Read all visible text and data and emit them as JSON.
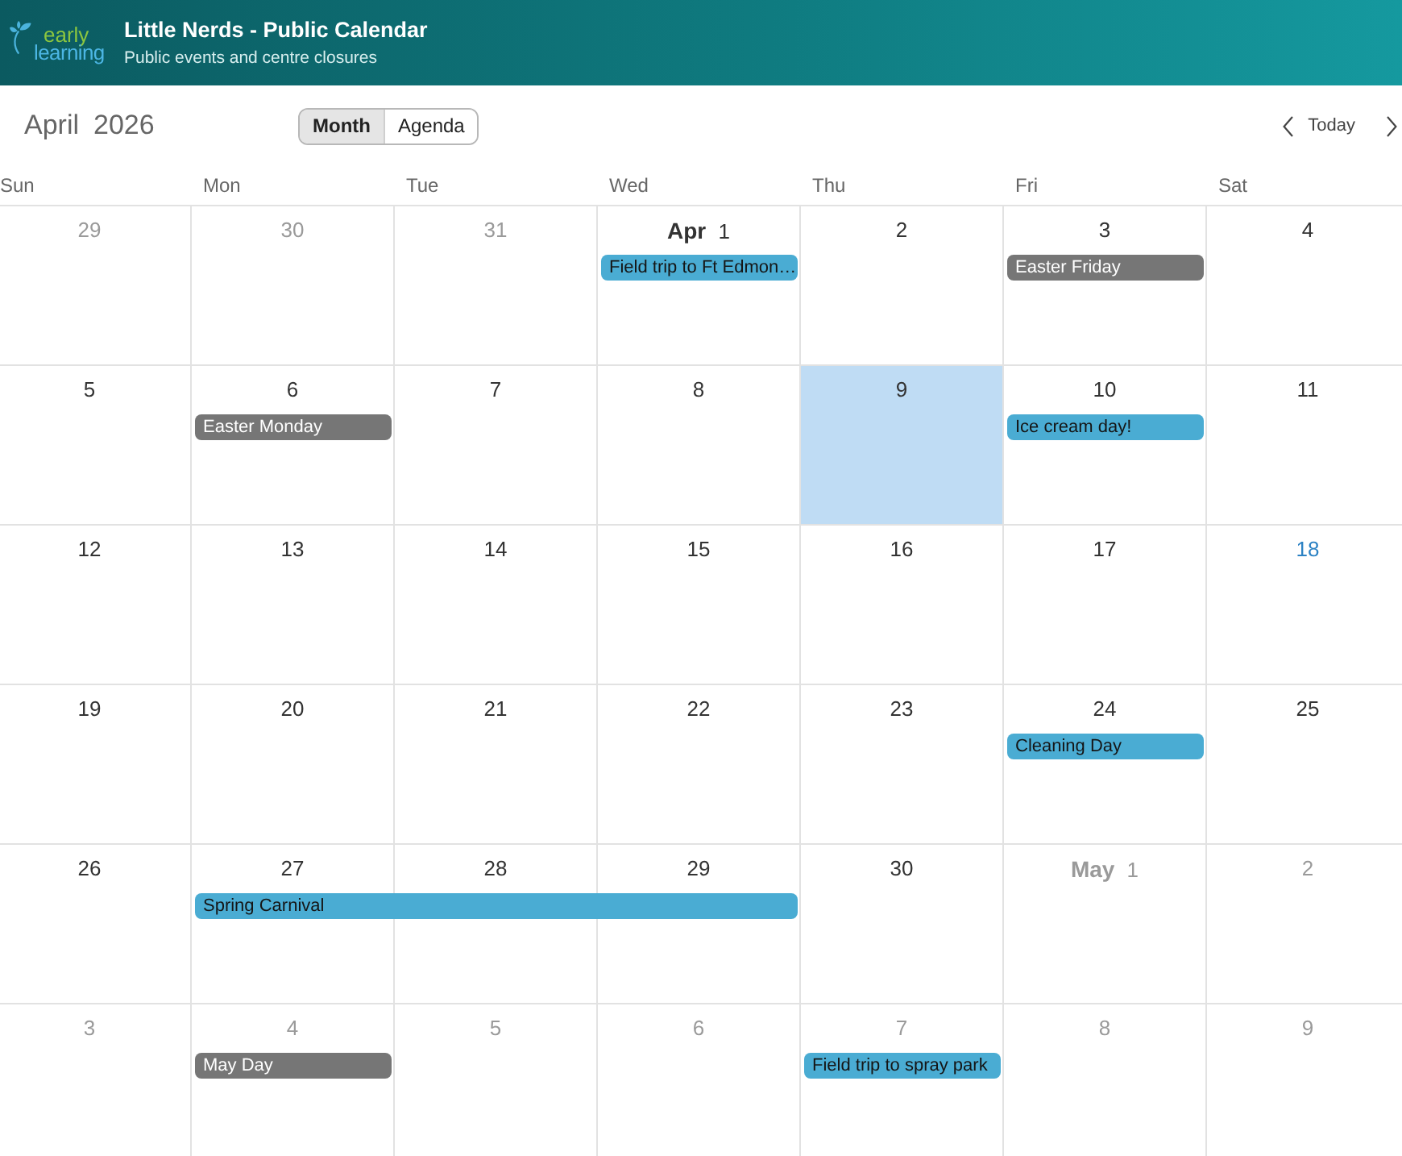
{
  "header": {
    "logo": {
      "line_1": "early",
      "line_2": "learning"
    },
    "title": "Little Nerds - Public Calendar",
    "subtitle": "Public events and centre closures"
  },
  "toolbar": {
    "month": "April",
    "year": "2026",
    "views": [
      {
        "label": "Month",
        "selected": true
      },
      {
        "label": "Agenda",
        "selected": false
      }
    ],
    "today_label": "Today"
  },
  "weekdays": [
    "Sun",
    "Mon",
    "Tue",
    "Wed",
    "Thu",
    "Fri",
    "Sat"
  ],
  "weeks": [
    {
      "days": [
        {
          "date": "29",
          "other_month": true,
          "today": false,
          "selected": false,
          "event_continues": false
        },
        {
          "date": "30",
          "other_month": true,
          "today": false,
          "selected": false,
          "event_continues": false
        },
        {
          "date": "31",
          "other_month": true,
          "today": false,
          "selected": false,
          "event_continues": false
        },
        {
          "date": "**Apr** 1",
          "other_month": false,
          "today": false,
          "selected": false,
          "event_continues": false,
          "events": [
            {
              "title": "Field trip to Ft Edmon…",
              "color": "#4aacd3"
            }
          ]
        },
        {
          "date": "2",
          "other_month": false,
          "today": false,
          "selected": false,
          "event_continues": false
        },
        {
          "date": "3",
          "other_month": false,
          "today": false,
          "selected": false,
          "event_continues": false,
          "events": [
            {
              "title": "Easter Friday",
              "color": "#767676"
            }
          ]
        },
        {
          "date": "4",
          "other_month": false,
          "today": false,
          "selected": false,
          "event_continues": false
        }
      ]
    },
    {
      "days": [
        {
          "date": "5",
          "other_month": false,
          "today": false,
          "selected": false,
          "event_continues": false
        },
        {
          "date": "6",
          "other_month": false,
          "today": false,
          "selected": false,
          "event_continues": false,
          "events": [
            {
              "title": "Easter Monday",
              "color": "#767676"
            }
          ]
        },
        {
          "date": "7",
          "other_month": false,
          "today": false,
          "selected": false,
          "event_continues": false
        },
        {
          "date": "8",
          "other_month": false,
          "today": false,
          "selected": false,
          "event_continues": false
        },
        {
          "date": "9",
          "other_month": false,
          "today": false,
          "selected": true,
          "event_continues": false
        },
        {
          "date": "10",
          "other_month": false,
          "today": false,
          "selected": false,
          "event_continues": false,
          "events": [
            {
              "title": "Ice cream day!",
              "color": "#4aacd3"
            }
          ]
        },
        {
          "date": "11",
          "other_month": false,
          "today": false,
          "selected": false,
          "event_continues": false
        }
      ]
    },
    {
      "days": [
        {
          "date": "12",
          "other_month": false,
          "today": false,
          "selected": false,
          "event_continues": false
        },
        {
          "date": "13",
          "other_month": false,
          "today": false,
          "selected": false,
          "event_continues": false
        },
        {
          "date": "14",
          "other_month": false,
          "today": false,
          "selected": false,
          "event_continues": false
        },
        {
          "date": "15",
          "other_month": false,
          "today": false,
          "selected": false,
          "event_continues": false
        },
        {
          "date": "16",
          "other_month": false,
          "today": false,
          "selected": false,
          "event_continues": false
        },
        {
          "date": "17",
          "other_month": false,
          "today": false,
          "selected": false,
          "event_continues": false
        },
        {
          "date": "18",
          "other_month": false,
          "today": true,
          "selected": false,
          "event_continues": false
        }
      ]
    },
    {
      "days": [
        {
          "date": "19",
          "other_month": false,
          "today": false,
          "selected": false,
          "event_continues": false
        },
        {
          "date": "20",
          "other_month": false,
          "today": false,
          "selected": false,
          "event_continues": false
        },
        {
          "date": "21",
          "other_month": false,
          "today": false,
          "selected": false,
          "event_continues": false
        },
        {
          "date": "22",
          "other_month": false,
          "today": false,
          "selected": false,
          "event_continues": false
        },
        {
          "date": "23",
          "other_month": false,
          "today": false,
          "selected": false,
          "event_continues": false
        },
        {
          "date": "24",
          "other_month": false,
          "today": false,
          "selected": false,
          "event_continues": false,
          "events": [
            {
              "title": "Cleaning Day",
              "color": "#4aacd3"
            }
          ]
        },
        {
          "date": "25",
          "other_month": false,
          "today": false,
          "selected": false,
          "event_continues": false
        }
      ]
    },
    {
      "days": [
        {
          "date": "26",
          "other_month": false,
          "today": false,
          "selected": false,
          "event_continues": false
        },
        {
          "date": "27",
          "other_month": false,
          "today": false,
          "selected": false,
          "event_continues": false,
          "events": [
            {
              "title": "Spring Carnival",
              "color": "#4aacd3"
            }
          ]
        },
        {
          "date": "28",
          "other_month": false,
          "today": false,
          "selected": false,
          "event_continues": true
        },
        {
          "date": "29",
          "other_month": false,
          "today": false,
          "selected": false,
          "event_continues": true
        },
        {
          "date": "30",
          "other_month": false,
          "today": false,
          "selected": false,
          "event_continues": false
        },
        {
          "date": "**May** 1",
          "other_month": true,
          "today": false,
          "selected": false,
          "event_continues": false
        },
        {
          "date": "2",
          "other_month": true,
          "today": false,
          "selected": false,
          "event_continues": false
        }
      ]
    },
    {
      "days": [
        {
          "date": "3",
          "other_month": true,
          "today": false,
          "selected": false,
          "event_continues": false
        },
        {
          "date": "4",
          "other_month": true,
          "today": false,
          "selected": false,
          "event_continues": false,
          "events": [
            {
              "title": "May Day",
              "color": "#767676"
            }
          ]
        },
        {
          "date": "5",
          "other_month": true,
          "today": false,
          "selected": false,
          "event_continues": false
        },
        {
          "date": "6",
          "other_month": true,
          "today": false,
          "selected": false,
          "event_continues": false
        },
        {
          "date": "7",
          "other_month": true,
          "today": false,
          "selected": false,
          "event_continues": false,
          "events": [
            {
              "title": "Field trip to spray park",
              "color": "#4aacd3"
            }
          ]
        },
        {
          "date": "8",
          "other_month": true,
          "today": false,
          "selected": false,
          "event_continues": false
        },
        {
          "date": "9",
          "other_month": true,
          "today": false,
          "selected": false,
          "event_continues": false
        }
      ]
    }
  ]
}
